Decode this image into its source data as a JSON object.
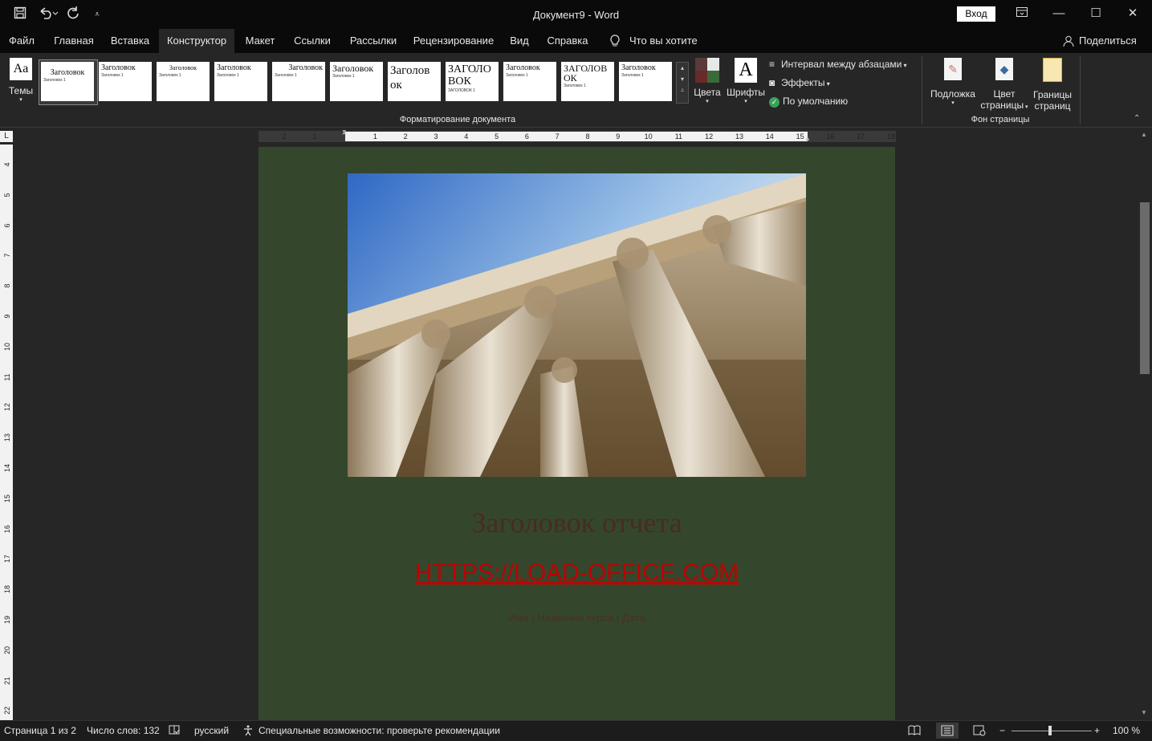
{
  "titlebar": {
    "doc_title": "Документ9  -  Word",
    "signin": "Вход",
    "icons": [
      "save-icon",
      "undo-icon",
      "redo-icon",
      "customize-icon"
    ]
  },
  "tabs": [
    "Файл",
    "Главная",
    "Вставка",
    "Конструктор",
    "Макет",
    "Ссылки",
    "Рассылки",
    "Рецензирование",
    "Вид",
    "Справка"
  ],
  "active_tab": "Конструктор",
  "tell_me": "Что вы хотите сделать?",
  "share": "Поделиться",
  "ribbon": {
    "themes": "Темы",
    "styles": [
      {
        "heading": "Заголовок",
        "sub": "Заголовок 1"
      },
      {
        "heading": "Заголовок",
        "sub": "Заголовок 1"
      },
      {
        "heading": "Заголовок",
        "sub": "Заголовок 1"
      },
      {
        "heading": "Заголовок",
        "sub": "Заголовок 1"
      },
      {
        "heading": "Заголовок",
        "sub": "Заголовок 1"
      },
      {
        "heading": "Заголовок",
        "sub": "Заголовок 1"
      },
      {
        "heading": "Заголов ок",
        "sub": ""
      },
      {
        "heading": "ЗАГОЛО ВОК",
        "sub": "ЗАГОЛОВОК 1"
      },
      {
        "heading": "Заголовок",
        "sub": "Заголовок 1"
      },
      {
        "heading": "ЗАГОЛОВ ОК",
        "sub": "Заголовок 1"
      },
      {
        "heading": "Заголовок",
        "sub": "Заголовок 1"
      }
    ],
    "colors": "Цвета",
    "fonts": "Шрифты",
    "fonts_glyph": "A",
    "spacing": "Интервал между абзацами",
    "effects": "Эффекты",
    "default": "По умолчанию",
    "format_group": "Форматирование документа",
    "watermark": "Подложка",
    "page_color_1": "Цвет",
    "page_color_2": "страницы",
    "borders_1": "Границы",
    "borders_2": "страниц",
    "background_group": "Фон страницы"
  },
  "ruler": {
    "h_ticks": [
      "2",
      "1",
      "1",
      "2",
      "3",
      "4",
      "5",
      "6",
      "7",
      "8",
      "9",
      "10",
      "11",
      "12",
      "13",
      "14",
      "15",
      "16",
      "17",
      "18"
    ],
    "v_ticks": [
      "4",
      "5",
      "6",
      "7",
      "8",
      "9",
      "10",
      "11",
      "12",
      "13",
      "14",
      "15",
      "16",
      "17",
      "18",
      "19",
      "20",
      "21",
      "22"
    ],
    "corner": "L"
  },
  "document": {
    "title": "Заголовок отчета",
    "link": "HTTPS://LOAD-OFFICE.COM",
    "meta": "Имя | Название курса | Дата"
  },
  "status": {
    "page": "Страница 1 из 2",
    "words": "Число слов: 132",
    "language": "русский",
    "accessibility": "Специальные возможности: проверьте рекомендации",
    "zoom": "100 %",
    "zoom_level": 1.0
  }
}
